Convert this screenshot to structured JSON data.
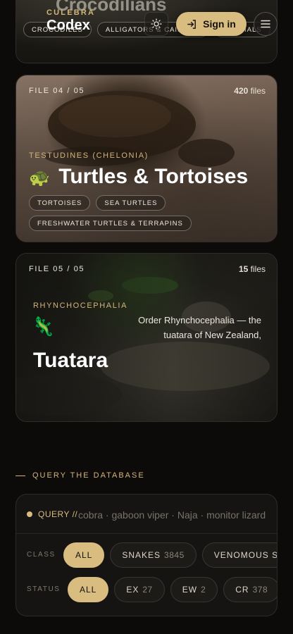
{
  "header": {
    "logo_top": "CULEBRA",
    "logo_main": "Codex",
    "signin_label": "Sign in",
    "icons": {
      "theme": "sun-icon",
      "signin": "sign-in-arrow-icon",
      "menu": "hamburger-menu-icon"
    }
  },
  "cards": {
    "prev": {
      "title": "Crocodilians",
      "chips": [
        "CROCODILES",
        "ALLIGATORS & CAIMANS",
        "GHARIALS"
      ]
    },
    "turtles": {
      "file_label": "FILE 04 / 05",
      "file_count": "420",
      "file_unit": "files",
      "order": "TESTUDINES (CHELONIA)",
      "emoji": "🐢",
      "title": "Turtles & Tortoises",
      "chips": [
        "TORTOISES",
        "SEA TURTLES",
        "FRESHWATER TURTLES & TERRAPINS"
      ]
    },
    "tuatara": {
      "file_label": "FILE 05 / 05",
      "file_count": "15",
      "file_unit": "files",
      "order": "RHYNCHOCEPHALIA",
      "emoji": "🦎",
      "title": "Tuatara",
      "description": "Order Rhynchocephalia — the tuatara of New Zealand,"
    }
  },
  "query": {
    "eyebrow": "QUERY THE DATABASE",
    "prefix": "QUERY //",
    "placeholder": "cobra · gaboon viper · Naja · monitor lizard",
    "class_label": "CLASS",
    "class_pills": [
      {
        "label": "ALL",
        "count": "",
        "active": true
      },
      {
        "label": "SNAKES",
        "count": "3845",
        "active": false
      },
      {
        "label": "VENOMOUS S",
        "count": "",
        "active": false
      }
    ],
    "status_label": "STATUS",
    "status_pills": [
      {
        "label": "ALL",
        "count": "",
        "active": true
      },
      {
        "label": "EX",
        "count": "27",
        "active": false
      },
      {
        "label": "EW",
        "count": "2",
        "active": false
      },
      {
        "label": "CR",
        "count": "378",
        "active": false
      }
    ]
  },
  "colors": {
    "accent": "#d8bc80",
    "gold_text": "#d3b57a",
    "background": "#0c0b0a"
  }
}
